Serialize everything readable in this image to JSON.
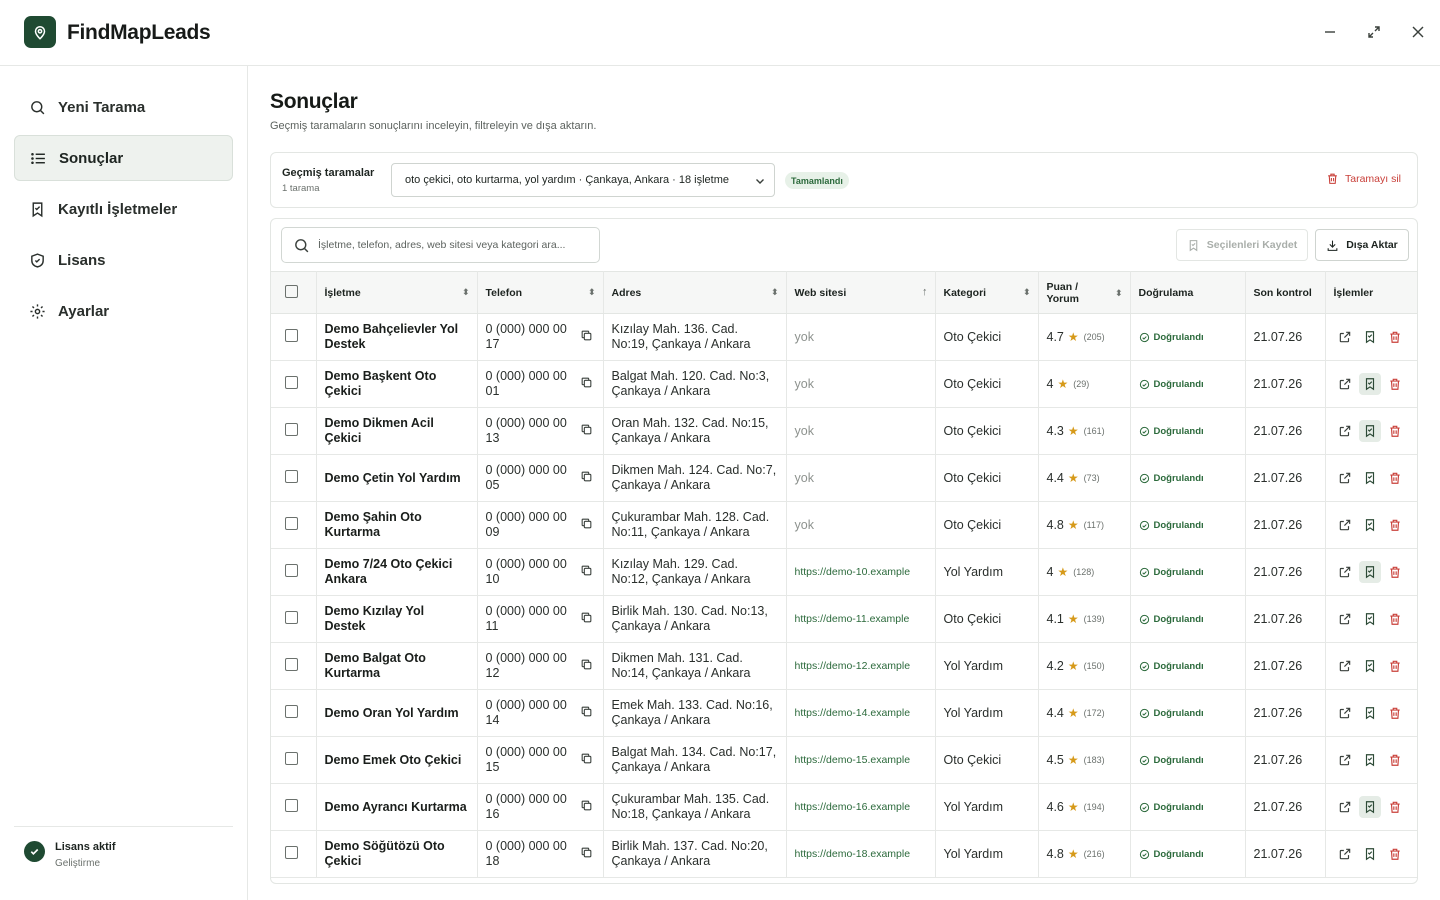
{
  "app": {
    "title": "FindMapLeads"
  },
  "sidebar": {
    "items": [
      {
        "label": "Yeni Tarama",
        "icon": "search-icon"
      },
      {
        "label": "Sonuçlar",
        "icon": "list-icon",
        "active": true
      },
      {
        "label": "Kayıtlı İşletmeler",
        "icon": "bookmark-icon"
      },
      {
        "label": "Lisans",
        "icon": "shield-icon"
      },
      {
        "label": "Ayarlar",
        "icon": "gear-icon"
      }
    ],
    "license": {
      "title": "Lisans aktif",
      "subtitle": "Geliştirme"
    }
  },
  "page": {
    "title": "Sonuçlar",
    "subtitle": "Geçmiş taramaların sonuçlarını inceleyin, filtreleyin ve dışa aktarın."
  },
  "scan": {
    "label": "Geçmiş taramalar",
    "count": "1 tarama",
    "selected": "oto çekici, oto kurtarma, yol yardım · Çankaya, Ankara · 18 işletme",
    "status": "Tamamlandı",
    "delete_label": "Taramayı sil"
  },
  "toolbar": {
    "search_placeholder": "İşletme, telefon, adres, web sitesi veya kategori ara...",
    "save_selected_label": "Seçilenleri Kaydet",
    "export_label": "Dışa Aktar"
  },
  "colors": {
    "brand": "#1f4a32",
    "accent_text": "#2c6a3c",
    "danger": "#c9403a",
    "star": "#d69a1a"
  },
  "table": {
    "columns": {
      "business": "İşletme",
      "phone": "Telefon",
      "address": "Adres",
      "website": "Web sitesi",
      "category": "Kategori",
      "rating": "Puan / Yorum",
      "verification": "Doğrulama",
      "last_check": "Son kontrol",
      "actions": "İşlemler"
    },
    "rows": [
      {
        "name": "Demo Bahçelievler Yol Destek",
        "phone": "0 (000) 000 00 17",
        "address": "Kızılay Mah. 136. Cad. No:19, Çankaya / Ankara",
        "website": "yok",
        "has_site": false,
        "category": "Oto Çekici",
        "rating": "4.7",
        "reviews": "(205)",
        "verify": "Doğrulandı",
        "last": "21.07.26",
        "saved": false
      },
      {
        "name": "Demo Başkent Oto Çekici",
        "phone": "0 (000) 000 00 01",
        "address": "Balgat Mah. 120. Cad. No:3, Çankaya / Ankara",
        "website": "yok",
        "has_site": false,
        "category": "Oto Çekici",
        "rating": "4",
        "reviews": "(29)",
        "verify": "Doğrulandı",
        "last": "21.07.26",
        "saved": true
      },
      {
        "name": "Demo Dikmen Acil Çekici",
        "phone": "0 (000) 000 00 13",
        "address": "Oran Mah. 132. Cad. No:15, Çankaya / Ankara",
        "website": "yok",
        "has_site": false,
        "category": "Oto Çekici",
        "rating": "4.3",
        "reviews": "(161)",
        "verify": "Doğrulandı",
        "last": "21.07.26",
        "saved": true
      },
      {
        "name": "Demo Çetin Yol Yardım",
        "phone": "0 (000) 000 00 05",
        "address": "Dikmen Mah. 124. Cad. No:7, Çankaya / Ankara",
        "website": "yok",
        "has_site": false,
        "category": "Oto Çekici",
        "rating": "4.4",
        "reviews": "(73)",
        "verify": "Doğrulandı",
        "last": "21.07.26",
        "saved": false
      },
      {
        "name": "Demo Şahin Oto Kurtarma",
        "phone": "0 (000) 000 00 09",
        "address": "Çukurambar Mah. 128. Cad. No:11, Çankaya / Ankara",
        "website": "yok",
        "has_site": false,
        "category": "Oto Çekici",
        "rating": "4.8",
        "reviews": "(117)",
        "verify": "Doğrulandı",
        "last": "21.07.26",
        "saved": false
      },
      {
        "name": "Demo 7/24 Oto Çekici Ankara",
        "phone": "0 (000) 000 00 10",
        "address": "Kızılay Mah. 129. Cad. No:12, Çankaya / Ankara",
        "website": "https://demo-10.example",
        "has_site": true,
        "category": "Yol Yardım",
        "rating": "4",
        "reviews": "(128)",
        "verify": "Doğrulandı",
        "last": "21.07.26",
        "saved": true
      },
      {
        "name": "Demo Kızılay Yol Destek",
        "phone": "0 (000) 000 00 11",
        "address": "Birlik Mah. 130. Cad. No:13, Çankaya / Ankara",
        "website": "https://demo-11.example",
        "has_site": true,
        "category": "Oto Çekici",
        "rating": "4.1",
        "reviews": "(139)",
        "verify": "Doğrulandı",
        "last": "21.07.26",
        "saved": false
      },
      {
        "name": "Demo Balgat Oto Kurtarma",
        "phone": "0 (000) 000 00 12",
        "address": "Dikmen Mah. 131. Cad. No:14, Çankaya / Ankara",
        "website": "https://demo-12.example",
        "has_site": true,
        "category": "Yol Yardım",
        "rating": "4.2",
        "reviews": "(150)",
        "verify": "Doğrulandı",
        "last": "21.07.26",
        "saved": false
      },
      {
        "name": "Demo Oran Yol Yardım",
        "phone": "0 (000) 000 00 14",
        "address": "Emek Mah. 133. Cad. No:16, Çankaya / Ankara",
        "website": "https://demo-14.example",
        "has_site": true,
        "category": "Yol Yardım",
        "rating": "4.4",
        "reviews": "(172)",
        "verify": "Doğrulandı",
        "last": "21.07.26",
        "saved": false
      },
      {
        "name": "Demo Emek Oto Çekici",
        "phone": "0 (000) 000 00 15",
        "address": "Balgat Mah. 134. Cad. No:17, Çankaya / Ankara",
        "website": "https://demo-15.example",
        "has_site": true,
        "category": "Oto Çekici",
        "rating": "4.5",
        "reviews": "(183)",
        "verify": "Doğrulandı",
        "last": "21.07.26",
        "saved": false
      },
      {
        "name": "Demo Ayrancı Kurtarma",
        "phone": "0 (000) 000 00 16",
        "address": "Çukurambar Mah. 135. Cad. No:18, Çankaya / Ankara",
        "website": "https://demo-16.example",
        "has_site": true,
        "category": "Yol Yardım",
        "rating": "4.6",
        "reviews": "(194)",
        "verify": "Doğrulandı",
        "last": "21.07.26",
        "saved": true
      },
      {
        "name": "Demo Söğütözü Oto Çekici",
        "phone": "0 (000) 000 00 18",
        "address": "Birlik Mah. 137. Cad. No:20, Çankaya / Ankara",
        "website": "https://demo-18.example",
        "has_site": true,
        "category": "Yol Yardım",
        "rating": "4.8",
        "reviews": "(216)",
        "verify": "Doğrulandı",
        "last": "21.07.26",
        "saved": false
      }
    ]
  }
}
